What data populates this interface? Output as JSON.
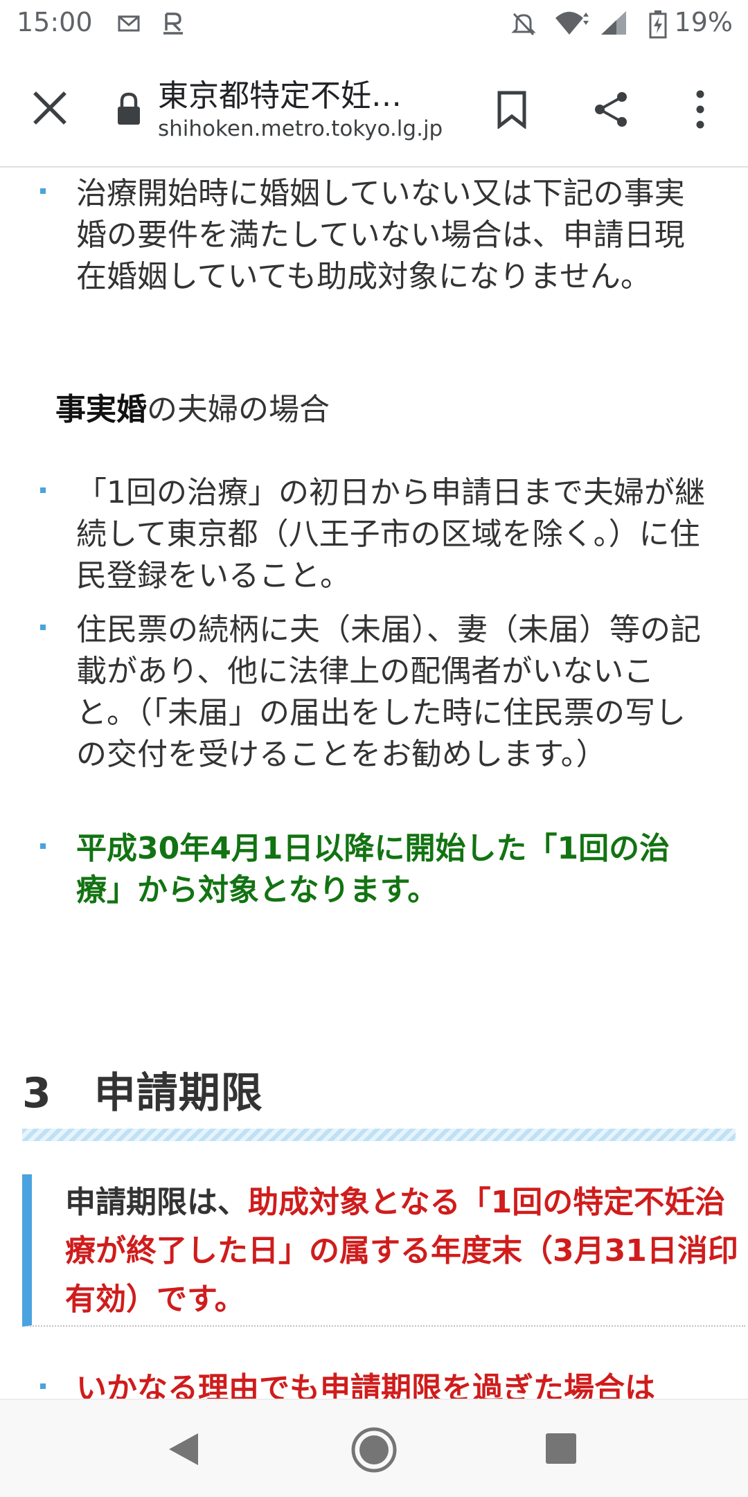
{
  "status_bar": {
    "time": "15:00",
    "battery": "19%",
    "icons": [
      "mail-icon",
      "rakuten-icon",
      "mute-icon",
      "wifi-icon",
      "signal-icon",
      "battery-icon"
    ]
  },
  "toolbar": {
    "title": "東京都特定不妊…",
    "domain": "shihoken.metro.tokyo.lg.jp"
  },
  "content": {
    "bullet1": "治療開始時に婚姻していない又は下記の事実婚の要件を満たしていない場合は、申請日現在婚姻していても助成対象になりません。",
    "subheading_bold": "事実婚",
    "subheading_rest": "の夫婦の場合",
    "bullet2": "「1回の治療」の初日から申請日まで夫婦が継続して東京都（八王子市の区域を除く。）に住民登録をいること。",
    "bullet3": "住民票の続柄に夫（未届）、妻（未届）等の記載があり、他に法律上の配偶者がいないこと。（「未届」の届出をした時に住民票の写しの交付を受けることをお勧めします。）",
    "bullet4": "平成30年4月1日以降に開始した「1回の治療」から対象となります。",
    "section_title": "3　申請期限",
    "callout_black": "申請期限は、",
    "callout_red": "助成対象となる「1回の特定不妊治療が終了した日」の属する年度末（3月31日消印有効）です。",
    "cut_bullet": "いかなる理由でも申請期限を過ぎた場合は"
  },
  "colors": {
    "accent_blue": "#4aa3df",
    "green": "#127312",
    "red": "#d01c1c"
  }
}
